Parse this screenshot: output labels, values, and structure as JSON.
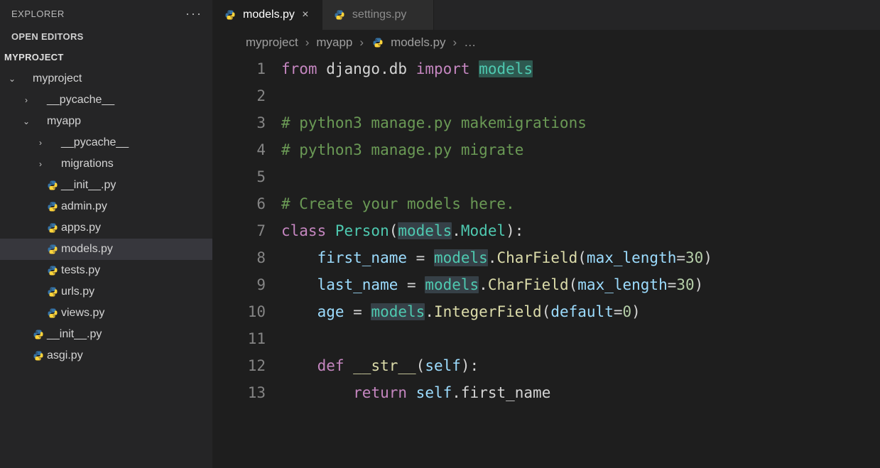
{
  "sidebar": {
    "title": "EXPLORER",
    "ellipsis": "···",
    "open_editors_label": "OPEN EDITORS",
    "root_label": "MYPROJECT",
    "tree": [
      {
        "label": "myproject",
        "type": "folder",
        "indent": 0,
        "expanded": true
      },
      {
        "label": "__pycache__",
        "type": "folder",
        "indent": 1,
        "expanded": false
      },
      {
        "label": "myapp",
        "type": "folder",
        "indent": 1,
        "expanded": true
      },
      {
        "label": "__pycache__",
        "type": "folder",
        "indent": 2,
        "expanded": false
      },
      {
        "label": "migrations",
        "type": "folder",
        "indent": 2,
        "expanded": false
      },
      {
        "label": "__init__.py",
        "type": "py",
        "indent": 2
      },
      {
        "label": "admin.py",
        "type": "py",
        "indent": 2
      },
      {
        "label": "apps.py",
        "type": "py",
        "indent": 2
      },
      {
        "label": "models.py",
        "type": "py",
        "indent": 2,
        "selected": true
      },
      {
        "label": "tests.py",
        "type": "py",
        "indent": 2
      },
      {
        "label": "urls.py",
        "type": "py",
        "indent": 2
      },
      {
        "label": "views.py",
        "type": "py",
        "indent": 2
      },
      {
        "label": "__init__.py",
        "type": "py",
        "indent": 1
      },
      {
        "label": "asgi.py",
        "type": "py",
        "indent": 1
      }
    ]
  },
  "tabs": [
    {
      "label": "models.py",
      "active": true,
      "icon": "python"
    },
    {
      "label": "settings.py",
      "active": false,
      "icon": "python"
    }
  ],
  "breadcrumbs": {
    "parts": [
      "myproject",
      "myapp",
      "models.py"
    ],
    "sep": "›",
    "trailing": "…"
  },
  "editor": {
    "lines": [
      {
        "n": 1,
        "tokens": [
          [
            "from ",
            "kw"
          ],
          [
            "django",
            ""
          ],
          [
            ".",
            ""
          ],
          [
            "db",
            ""
          ],
          [
            " ",
            ""
          ],
          [
            "import ",
            "kw"
          ],
          [
            "models",
            "mod hl2"
          ]
        ]
      },
      {
        "n": 2,
        "tokens": [
          [
            "",
            ""
          ]
        ]
      },
      {
        "n": 3,
        "tokens": [
          [
            "# python3 manage.py makemigrations",
            "cmt"
          ]
        ]
      },
      {
        "n": 4,
        "tokens": [
          [
            "# python3 manage.py migrate",
            "cmt"
          ]
        ]
      },
      {
        "n": 5,
        "tokens": [
          [
            "",
            ""
          ]
        ]
      },
      {
        "n": 6,
        "tokens": [
          [
            "# Create your models here.",
            "cmt"
          ]
        ]
      },
      {
        "n": 7,
        "tokens": [
          [
            "class ",
            "kw"
          ],
          [
            "Person",
            "cls"
          ],
          [
            "(",
            ""
          ],
          [
            "models",
            "mod hl"
          ],
          [
            ".",
            ""
          ],
          [
            "Model",
            "cls"
          ],
          [
            "):",
            ""
          ]
        ]
      },
      {
        "n": 8,
        "tokens": [
          [
            "    ",
            ""
          ],
          [
            "first_name",
            "var"
          ],
          [
            " = ",
            ""
          ],
          [
            "models",
            "mod hl"
          ],
          [
            ".",
            ""
          ],
          [
            "CharField",
            "call"
          ],
          [
            "(",
            ""
          ],
          [
            "max_length",
            "param"
          ],
          [
            "=",
            ""
          ],
          [
            "30",
            "num"
          ],
          [
            ")",
            ""
          ]
        ]
      },
      {
        "n": 9,
        "tokens": [
          [
            "    ",
            ""
          ],
          [
            "last_name",
            "var"
          ],
          [
            " = ",
            ""
          ],
          [
            "models",
            "mod hl"
          ],
          [
            ".",
            ""
          ],
          [
            "CharField",
            "call"
          ],
          [
            "(",
            ""
          ],
          [
            "max_length",
            "param"
          ],
          [
            "=",
            ""
          ],
          [
            "30",
            "num"
          ],
          [
            ")",
            ""
          ]
        ]
      },
      {
        "n": 10,
        "tokens": [
          [
            "    ",
            ""
          ],
          [
            "age",
            "var"
          ],
          [
            " = ",
            ""
          ],
          [
            "models",
            "mod hl"
          ],
          [
            ".",
            ""
          ],
          [
            "IntegerField",
            "call"
          ],
          [
            "(",
            ""
          ],
          [
            "default",
            "param"
          ],
          [
            "=",
            ""
          ],
          [
            "0",
            "num"
          ],
          [
            ")",
            ""
          ]
        ]
      },
      {
        "n": 11,
        "tokens": [
          [
            "",
            ""
          ]
        ]
      },
      {
        "n": 12,
        "tokens": [
          [
            "    ",
            ""
          ],
          [
            "def ",
            "kw"
          ],
          [
            "__str__",
            "fn"
          ],
          [
            "(",
            ""
          ],
          [
            "self",
            "self"
          ],
          [
            "):",
            ""
          ]
        ]
      },
      {
        "n": 13,
        "tokens": [
          [
            "        ",
            ""
          ],
          [
            "return ",
            "kw"
          ],
          [
            "self",
            "self"
          ],
          [
            ".",
            ""
          ],
          [
            "first_name",
            ""
          ]
        ]
      }
    ]
  }
}
